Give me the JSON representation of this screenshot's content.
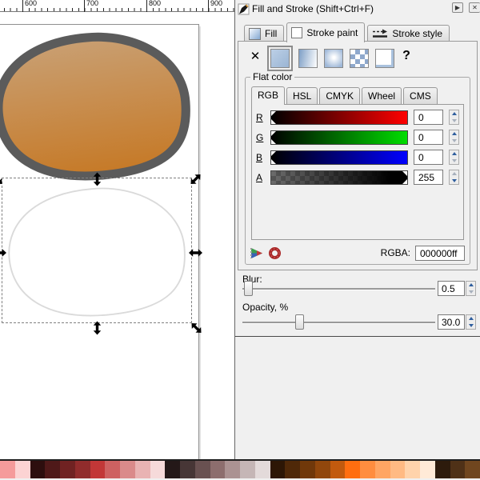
{
  "ruler": {
    "labels": [
      "600",
      "700",
      "800",
      "900"
    ]
  },
  "canvas": {
    "shape_stroke_color": "#5B5B5B",
    "shape_gradient_top": "#C9A074",
    "shape_gradient_bottom": "#C67926",
    "ghost_outline_color": "#DADADA",
    "ghost_fill_color": "#FFFFFF"
  },
  "dialog": {
    "title": "Fill and Stroke (Shift+Ctrl+F)",
    "detach_glyph": "▶",
    "close_glyph": "✕",
    "tabs": {
      "fill": "Fill",
      "stroke_paint": "Stroke paint",
      "stroke_style": "Stroke style"
    },
    "paint": {
      "none_glyph": "✕",
      "help_glyph": "?"
    },
    "flat": {
      "label": "Flat color",
      "tabs": [
        "RGB",
        "HSL",
        "CMYK",
        "Wheel",
        "CMS"
      ],
      "channels": [
        {
          "label": "R",
          "value": "0",
          "color": "#FF0000"
        },
        {
          "label": "G",
          "value": "0",
          "color": "#00DD00"
        },
        {
          "label": "B",
          "value": "0",
          "color": "#0000FF"
        },
        {
          "label": "A",
          "value": "255",
          "color": "#000000"
        }
      ],
      "rgba_label": "RGBA:",
      "rgba_value": "000000ff"
    },
    "blur": {
      "label": "Blur:",
      "value": "0.5"
    },
    "opacity": {
      "label": "Opacity, %",
      "value": "30.0"
    }
  },
  "palette": {
    "colors": [
      "#F59B9B",
      "#FCD3D3",
      "#2D0E0E",
      "#4F1919",
      "#702222",
      "#912C2C",
      "#C23737",
      "#CE6161",
      "#DA8A8A",
      "#E9B3B3",
      "#F6DADA",
      "#241818",
      "#473636",
      "#695151",
      "#8D6E6E",
      "#AB9292",
      "#C5B6B6",
      "#E3DADA",
      "#2D1605",
      "#4F2808",
      "#70380A",
      "#91470C",
      "#C25A0E",
      "#FF6E10",
      "#FF8D3F",
      "#FFA563",
      "#FFBA83",
      "#FFD3AB",
      "#FFEAD7",
      "#2D1B0C",
      "#4F3117",
      "#70461F"
    ]
  }
}
